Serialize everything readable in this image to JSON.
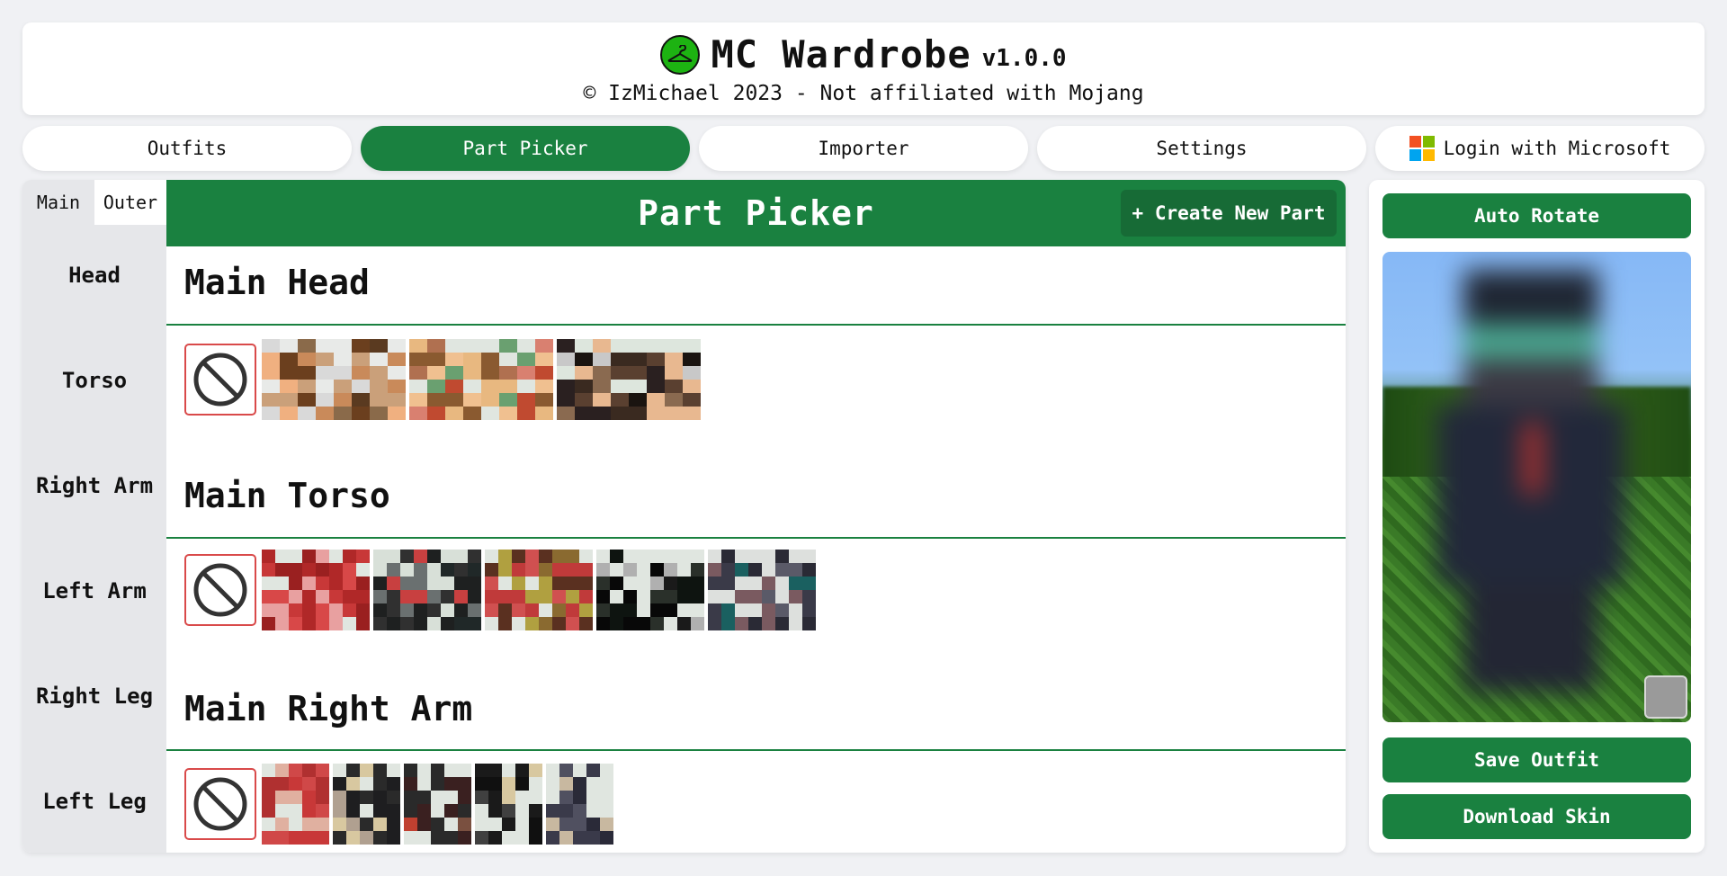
{
  "header": {
    "title": "MC Wardrobe",
    "version": "v1.0.0",
    "subtitle": "© IzMichael 2023 - Not affiliated with Mojang",
    "logo_icon": "hanger-icon",
    "logo_color": "#1db312"
  },
  "nav": {
    "outfits": "Outfits",
    "part_picker": "Part Picker",
    "importer": "Importer",
    "settings": "Settings",
    "login": "Login with Microsoft",
    "active": "Part Picker"
  },
  "sidebar": {
    "tabs": {
      "main": "Main",
      "outer": "Outer"
    },
    "items": [
      "Head",
      "Torso",
      "Right Arm",
      "Left Arm",
      "Right Leg",
      "Left Leg"
    ]
  },
  "picker": {
    "title": "Part Picker",
    "create_button": "+ Create New Part",
    "sections": [
      {
        "title": "Main Head",
        "part_count": 3
      },
      {
        "title": "Main Torso",
        "part_count": 5
      },
      {
        "title": "Main Right Arm",
        "part_count": 5
      }
    ]
  },
  "viewer": {
    "auto_rotate": "Auto Rotate",
    "save_outfit": "Save Outfit",
    "download_skin": "Download Skin"
  },
  "colors": {
    "accent": "#1a8140",
    "accent_dark": "#176b36",
    "none_border": "#d94a4a",
    "page_bg": "#f0f1f4"
  }
}
